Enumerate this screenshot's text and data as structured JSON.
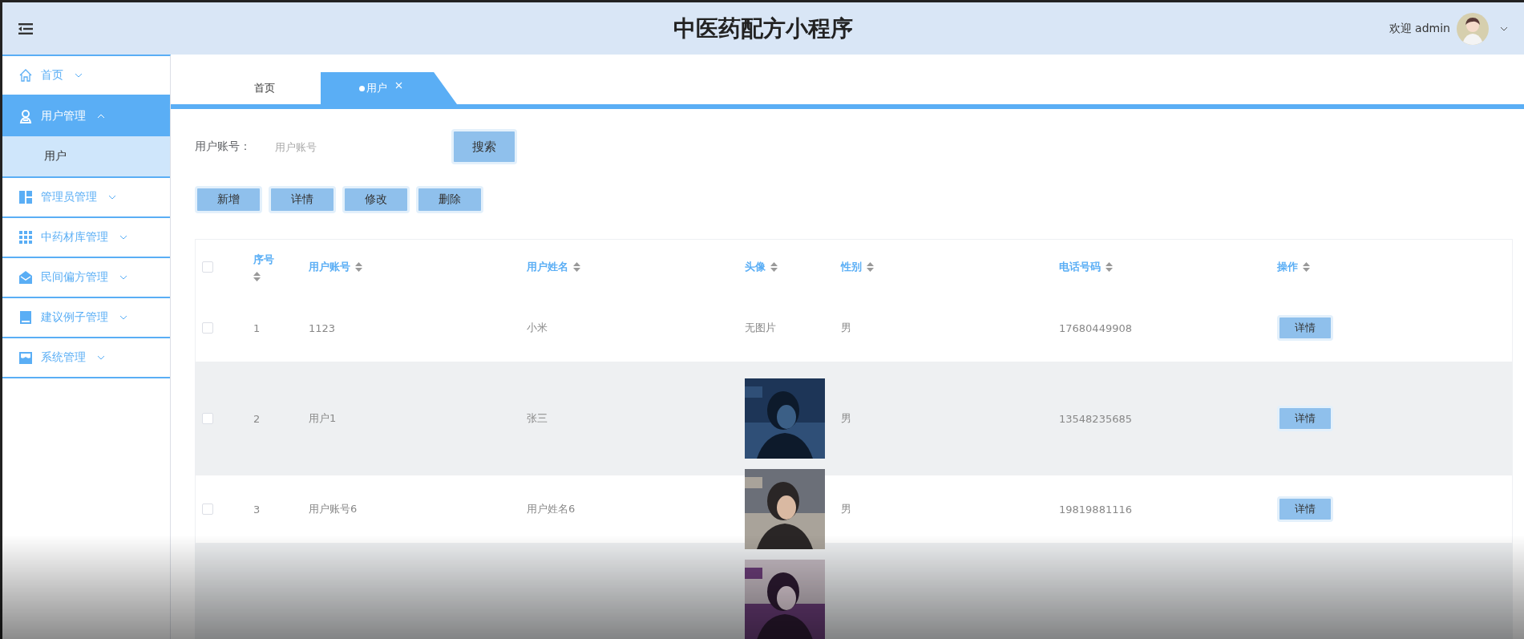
{
  "header": {
    "title": "中医药配方小程序",
    "welcome": "欢迎 admin"
  },
  "sidebar": {
    "items": [
      {
        "label": "首页",
        "expanded": false,
        "selected": false
      },
      {
        "label": "用户管理",
        "expanded": true,
        "selected": true,
        "children": [
          {
            "label": "用户",
            "selected": true
          }
        ]
      },
      {
        "label": "管理员管理",
        "expanded": false,
        "selected": false
      },
      {
        "label": "中药材库管理",
        "expanded": false,
        "selected": false
      },
      {
        "label": "民间偏方管理",
        "expanded": false,
        "selected": false
      },
      {
        "label": "建议例子管理",
        "expanded": false,
        "selected": false
      },
      {
        "label": "系统管理",
        "expanded": false,
        "selected": false
      }
    ]
  },
  "tabs": [
    {
      "label": "首页",
      "selected": false
    },
    {
      "label": "用户",
      "selected": true,
      "closable": true
    }
  ],
  "search": {
    "label": "用户账号：",
    "placeholder": "用户账号",
    "button": "搜索"
  },
  "actions": [
    "新增",
    "详情",
    "修改",
    "删除"
  ],
  "table": {
    "all_checked": false,
    "columns": [
      {
        "label": "序号",
        "sortable": true
      },
      {
        "label": "用户账号",
        "sortable": true
      },
      {
        "label": "用户姓名",
        "sortable": true
      },
      {
        "label": "头像",
        "sortable": true
      },
      {
        "label": "性别",
        "sortable": true
      },
      {
        "label": "电话号码",
        "sortable": true
      },
      {
        "label": "操作",
        "sortable": true
      }
    ],
    "rows": [
      {
        "checked": false,
        "cells": [
          "1",
          "1123",
          "小米"
        ],
        "avatar": {
          "kind": "text",
          "text": "无图片"
        },
        "gender": "男",
        "phone": "17680449908",
        "action": "详情"
      },
      {
        "checked": false,
        "cells": [
          "2",
          "用户1",
          "张三"
        ],
        "avatar": {
          "kind": "picture"
        },
        "gender": "男",
        "phone": "13548235685",
        "action": "详情"
      },
      {
        "checked": false,
        "cells": [
          "3",
          "用户账号6",
          "用户姓名6"
        ],
        "avatar": {
          "kind": "picture"
        },
        "gender": "男",
        "phone": "19819881116",
        "action": "详情"
      },
      {
        "avatar": {
          "kind": "picture"
        }
      }
    ]
  }
}
